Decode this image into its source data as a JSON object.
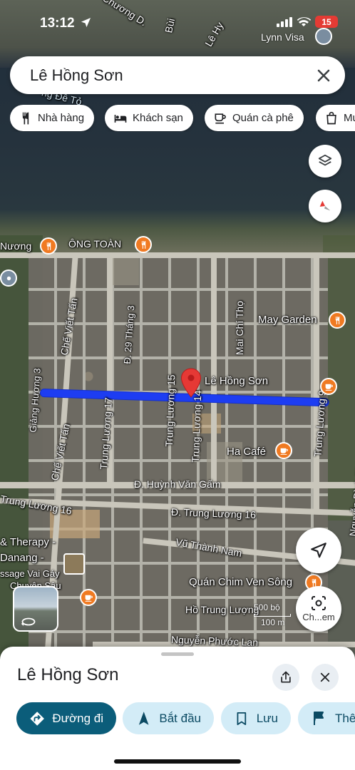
{
  "status": {
    "time": "13:12",
    "battery": "15",
    "carrier_label": "Lynn Visa"
  },
  "search": {
    "value": "Lê Hồng Sơn"
  },
  "chips": [
    {
      "label": "Nhà hàng",
      "icon": "restaurant-icon"
    },
    {
      "label": "Khách sạn",
      "icon": "hotel-icon"
    },
    {
      "label": "Quán cà phê",
      "icon": "coffee-icon"
    },
    {
      "label": "Mu",
      "icon": "shopping-bag-icon"
    }
  ],
  "map": {
    "route_color": "#1d3df2",
    "pin_label": "Lê Hồng Sơn",
    "street_labels": [
      "Chương D.",
      "Bùi",
      "Lê Hy",
      "ng Đê Tỏ",
      "Nương",
      "ÔNG TOÀN",
      "Chế Viết Tấn",
      "Đ. 29 Tháng 3",
      "Mai Chí Thọ",
      "Giảng Hương 3",
      "Trung Lương 17",
      "Trung Lương 15",
      "Trung Lương 14",
      "Trung Lương 9",
      "Nguyễn Đình Thi",
      "Chế Viết Tấn",
      "Đ. Huỳnh Văn Gấm",
      "Trung Lương 16",
      "Đ. Trung Lương 16",
      "Vũ Thành Nam",
      "Hồ Trung Lượng",
      "Nguyễn Phước Lan"
    ],
    "poi_labels": {
      "may_garden": "May Garden",
      "ha_cafe": "Ha Café",
      "quan_chim": "Quán Chim Ven Sông",
      "therapy_line1": "& Therapy -",
      "therapy_line2": "Danang -",
      "therapy_line3": "ssage Vai Gáy",
      "therapy_line4": "Chuyên Sâu"
    },
    "scale": {
      "ft": "500 bộ",
      "m": "100 m"
    },
    "lens_label": "Ch...em"
  },
  "sheet": {
    "title": "Lê Hồng Sơn",
    "actions": [
      {
        "label": "Đường đi",
        "icon": "directions-icon"
      },
      {
        "label": "Bắt đầu",
        "icon": "navigation-icon"
      },
      {
        "label": "Lưu",
        "icon": "bookmark-icon"
      },
      {
        "label": "Thê",
        "icon": "flag-icon"
      }
    ]
  },
  "colors": {
    "accent": "#0b5d7a",
    "poi": "#f07a22",
    "pin": "#e53935",
    "battery": "#e43b34"
  }
}
